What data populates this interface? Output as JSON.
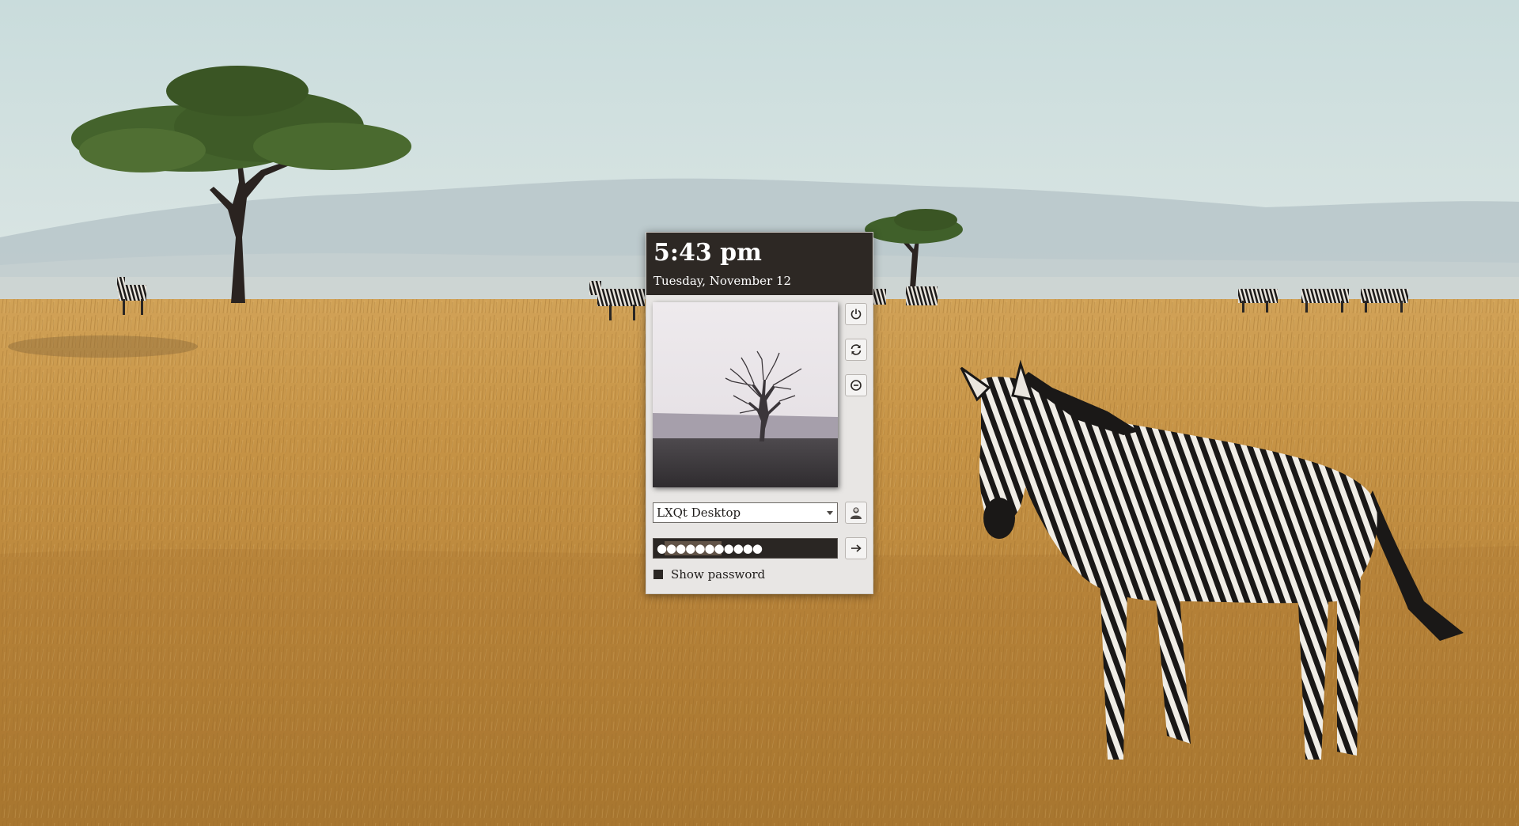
{
  "wallpaper": {
    "description_icon": "savanna-wallpaper"
  },
  "greeter": {
    "clock": {
      "time": "5:43 pm",
      "date": "Tuesday, November 12"
    },
    "avatar_icon": "tree-avatar",
    "actions": {
      "power_icon": "power-icon",
      "reboot_icon": "reboot-icon",
      "suspend_icon": "suspend-icon",
      "user_switch_icon": "user-icon",
      "login_icon": "arrow-right-icon"
    },
    "session": {
      "selected": "LXQt Desktop"
    },
    "password": {
      "masked_value": "●●●●●●●●●●●"
    },
    "show_password": {
      "label": "Show password",
      "checked": true
    }
  },
  "colors": {
    "header_bg": "#2d2824",
    "panel_bg": "#e8e6e4",
    "password_bg": "#2a2623"
  }
}
